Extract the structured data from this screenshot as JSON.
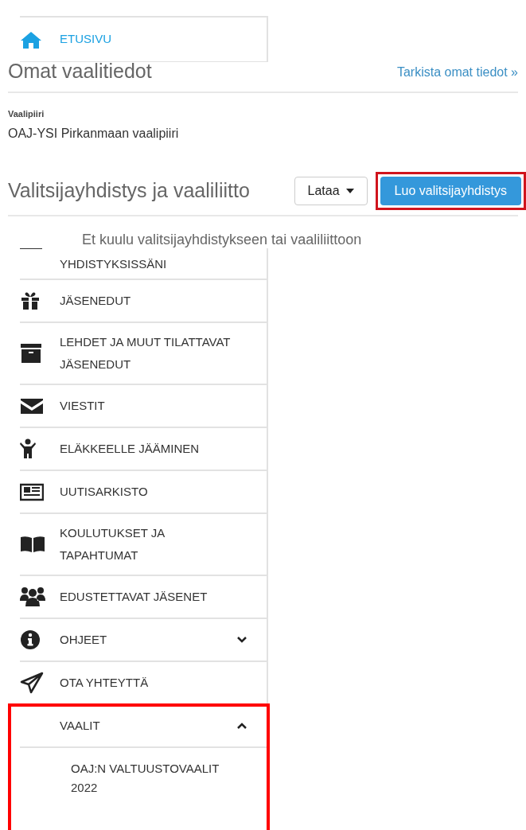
{
  "top_menu": [
    {
      "label": "ETUSIVU",
      "kind": "home",
      "active": true
    }
  ],
  "own_info": {
    "title": "Omat vaalitiedot",
    "link": "Tarkista omat tiedot »",
    "field_label": "Vaalipiiri",
    "field_value": "OAJ-YSI Pirkanmaan vaalipiiri"
  },
  "association": {
    "title": "Valitsijayhdistys ja vaaliliitto",
    "buttons": [
      {
        "label": "Lataa",
        "kind": "dropdown",
        "highlighted": false
      },
      {
        "label": "Luo valitsijayhdistys",
        "kind": "primary",
        "highlighted": true
      }
    ],
    "message": "Et kuulu valitsijayhdistykseen tai vaaliliittoon"
  },
  "side_menu": [
    {
      "label": "YHDISTYKSISSÄNI",
      "kind": "plain",
      "highlighted": false
    },
    {
      "label": "JÄSENEDUT",
      "kind": "gift",
      "highlighted": false
    },
    {
      "label": "LEHDET JA MUUT TILATTAVAT JÄSENEDUT",
      "kind": "archive",
      "highlighted": false
    },
    {
      "label": "VIESTIT",
      "kind": "envelope",
      "highlighted": false
    },
    {
      "label": "ELÄKKEELLE JÄÄMINEN",
      "kind": "child",
      "highlighted": false
    },
    {
      "label": "UUTISARKISTO",
      "kind": "newspaper",
      "highlighted": false
    },
    {
      "label": "KOULUTUKSET JA TAPAHTUMAT",
      "kind": "book",
      "highlighted": false
    },
    {
      "label": "EDUSTETTAVAT JÄSENET",
      "kind": "users",
      "highlighted": false
    },
    {
      "label": "OHJEET",
      "kind": "info",
      "expanded": false,
      "highlighted": false
    },
    {
      "label": "OTA YHTEYTTÄ",
      "kind": "plane",
      "highlighted": false
    },
    {
      "label": "VAALIT",
      "kind": "plain",
      "expanded": true,
      "highlighted": true,
      "children": [
        {
          "label": "OAJ:N VALTUUSTOVAALIT 2022"
        }
      ]
    }
  ]
}
